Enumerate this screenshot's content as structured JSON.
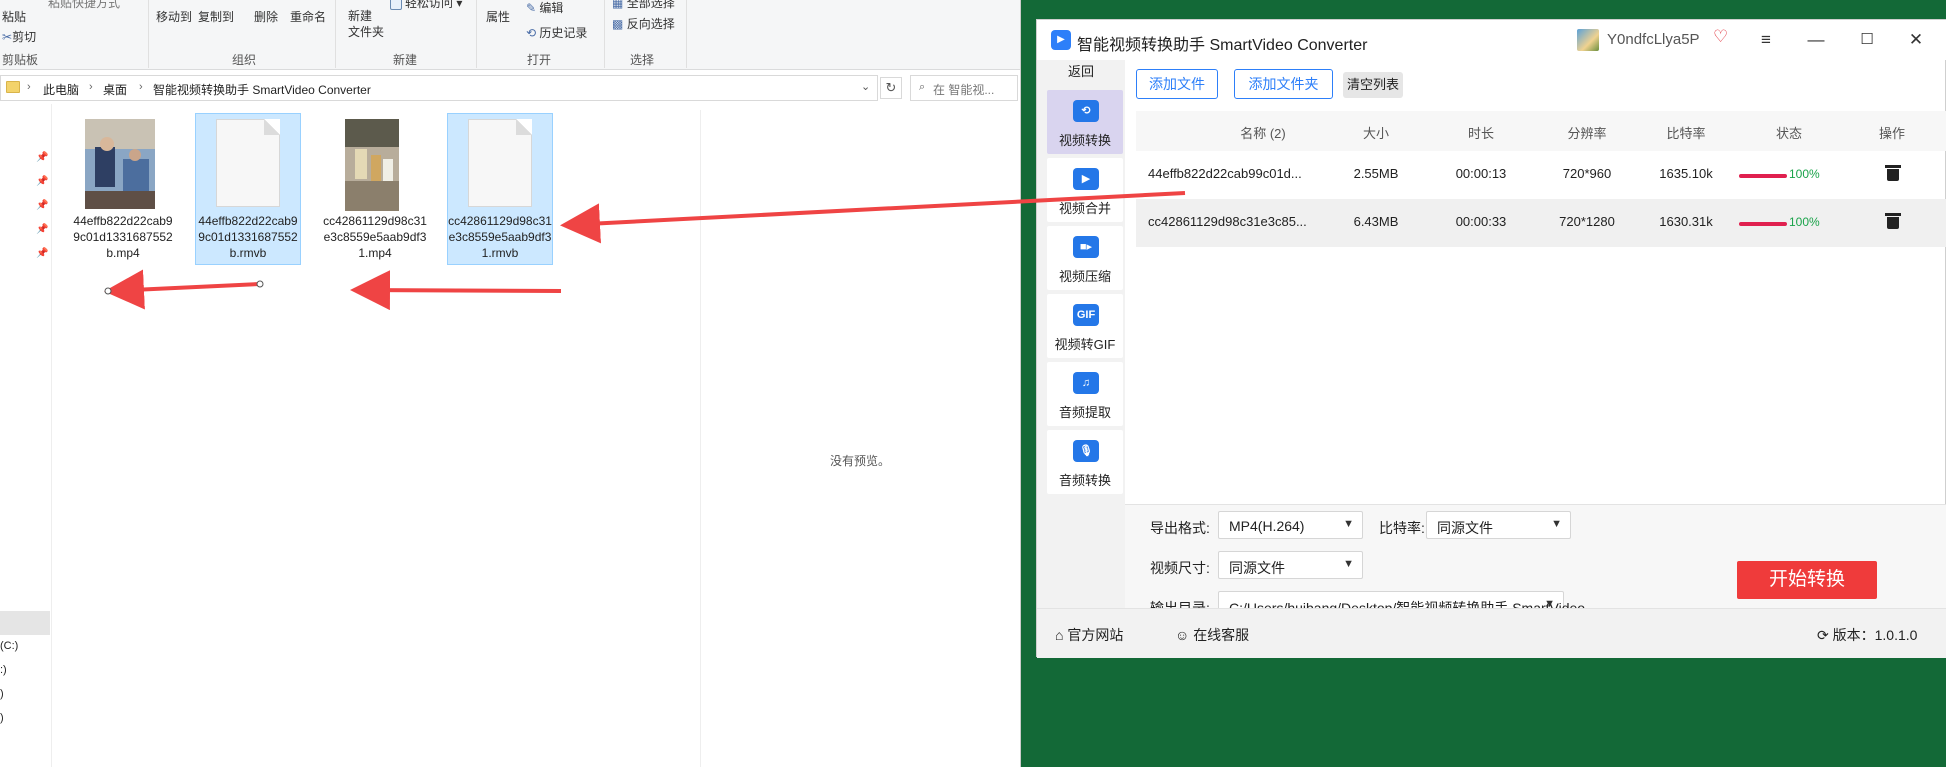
{
  "explorer": {
    "ribbon": {
      "paste": "粘贴",
      "paste_shortcut": "粘贴快捷方式",
      "cut": "剪切",
      "clipboard_group": "剪贴板",
      "move_to": "移动到",
      "copy_to": "复制到",
      "delete": "删除",
      "rename": "重命名",
      "organize_group": "组织",
      "new_folder": "新建\n文件夹",
      "easy_access": "轻松访问",
      "new_group": "新建",
      "properties": "属性",
      "edit": "编辑",
      "history": "历史记录",
      "open_group": "打开",
      "select_all": "全部选择",
      "invert_selection": "反向选择",
      "select_group": "选择"
    },
    "address": {
      "crumbs": [
        "此电脑",
        "桌面",
        "智能视频转换助手 SmartVideo Converter"
      ],
      "search_placeholder": "在 智能视..."
    },
    "drives": [
      "(C:)",
      ":)",
      ")",
      ")"
    ],
    "files": [
      {
        "name": "44effb822d22cab99c01d1331687552b.mp4",
        "selected": false,
        "kind": "video"
      },
      {
        "name": "44effb822d22cab99c01d1331687552b.rmvb",
        "selected": true,
        "kind": "doc"
      },
      {
        "name": "cc42861129d98c31e3c8559e5aab9df31.mp4",
        "selected": false,
        "kind": "video"
      },
      {
        "name": "cc42861129d98c31e3c8559e5aab9df31.rmvb",
        "selected": true,
        "kind": "doc"
      }
    ],
    "no_preview": "没有预览。"
  },
  "app": {
    "title": "智能视频转换助手 SmartVideo Converter",
    "user": "Y0ndfcLlya5P",
    "sidebar": {
      "back": "返回",
      "items": [
        {
          "label": "视频转换",
          "icon": "video-convert-icon",
          "active": true
        },
        {
          "label": "视频合并",
          "icon": "video-merge-icon",
          "active": false
        },
        {
          "label": "视频压缩",
          "icon": "video-compress-icon",
          "active": false
        },
        {
          "label": "视频转GIF",
          "icon": "gif-icon",
          "active": false
        },
        {
          "label": "音频提取",
          "icon": "music-note-icon",
          "active": false
        },
        {
          "label": "音频转换",
          "icon": "microphone-icon",
          "active": false
        }
      ]
    },
    "toolbar": {
      "add_file": "添加文件",
      "add_folder": "添加文件夹",
      "clear_list": "清空列表"
    },
    "table": {
      "headers": [
        "名称 (2)",
        "大小",
        "时长",
        "分辨率",
        "比特率",
        "状态",
        "操作"
      ],
      "rows": [
        {
          "name": "44effb822d22cab99c01d...",
          "size": "2.55MB",
          "duration": "00:00:13",
          "resolution": "720*960",
          "bitrate": "1635.10k",
          "progress": 1.0,
          "status": "100%"
        },
        {
          "name": "cc42861129d98c31e3c85...",
          "size": "6.43MB",
          "duration": "00:00:33",
          "resolution": "720*1280",
          "bitrate": "1630.31k",
          "progress": 1.0,
          "status": "100%"
        }
      ]
    },
    "settings": {
      "format_label": "导出格式:",
      "format_value": "MP4(H.264)",
      "bitrate_label": "比特率:",
      "bitrate_value": "同源文件",
      "size_label": "视频尺寸:",
      "size_value": "同源文件",
      "output_label": "输出目录:",
      "output_value": "C:/Users/huibang/Desktop/智能视频转换助手 SmartVideo",
      "start": "开始转换"
    },
    "statusbar": {
      "website": "官方网站",
      "support": "在线客服",
      "version": "版本：1.0.1.0"
    }
  },
  "colors": {
    "desktop_green": "#136937",
    "accent_blue": "#2d7ff9",
    "start_red": "#ef3b3b",
    "progress_red": "#e0204f",
    "status_green": "#1aa34a",
    "selection_blue": "#cce8ff"
  }
}
